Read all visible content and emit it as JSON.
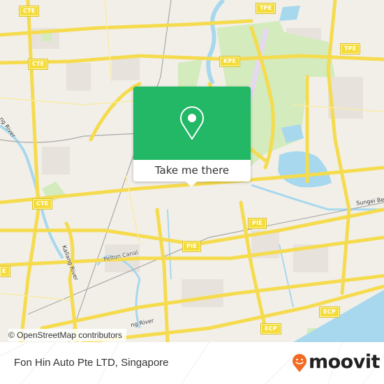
{
  "map": {
    "highway_shields": [
      {
        "label": "CTE",
        "id": "cte-1"
      },
      {
        "label": "CTE",
        "id": "cte-2"
      },
      {
        "label": "CTE",
        "id": "cte-3"
      },
      {
        "label": "E",
        "id": "cte-4-partial"
      },
      {
        "label": "TPE",
        "id": "tpe-1"
      },
      {
        "label": "TPE",
        "id": "tpe-2"
      },
      {
        "label": "KPE",
        "id": "kpe-1"
      },
      {
        "label": "PIE",
        "id": "pie-1"
      },
      {
        "label": "PIE",
        "id": "pie-2"
      },
      {
        "label": "ECP",
        "id": "ecp-1"
      },
      {
        "label": "ECP",
        "id": "ecp-2"
      }
    ],
    "place_labels": [
      {
        "text": "ng River",
        "id": "kallang-river-north"
      },
      {
        "text": "Kallang River",
        "id": "kallang-river-mid"
      },
      {
        "text": "Pelton Canal",
        "id": "pelton-canal"
      },
      {
        "text": "Sungei Bedok",
        "id": "sungei-bedok"
      },
      {
        "text": "ng River",
        "id": "geylang-river"
      }
    ],
    "attribution": "© OpenStreetMap contributors",
    "colors": {
      "land": "#f2efe9",
      "road": "#f7e160",
      "water": "#9fd3ea",
      "park": "#cfe8b4",
      "sea": "#9fd3ea"
    }
  },
  "popup": {
    "icon": "location-pin-icon",
    "action_label": "Take me there",
    "color": "#22b866"
  },
  "footer": {
    "place_name": "Fon Hin Auto Pte LTD, Singapore",
    "brand": "moovit",
    "brand_color": "#f26b21"
  }
}
